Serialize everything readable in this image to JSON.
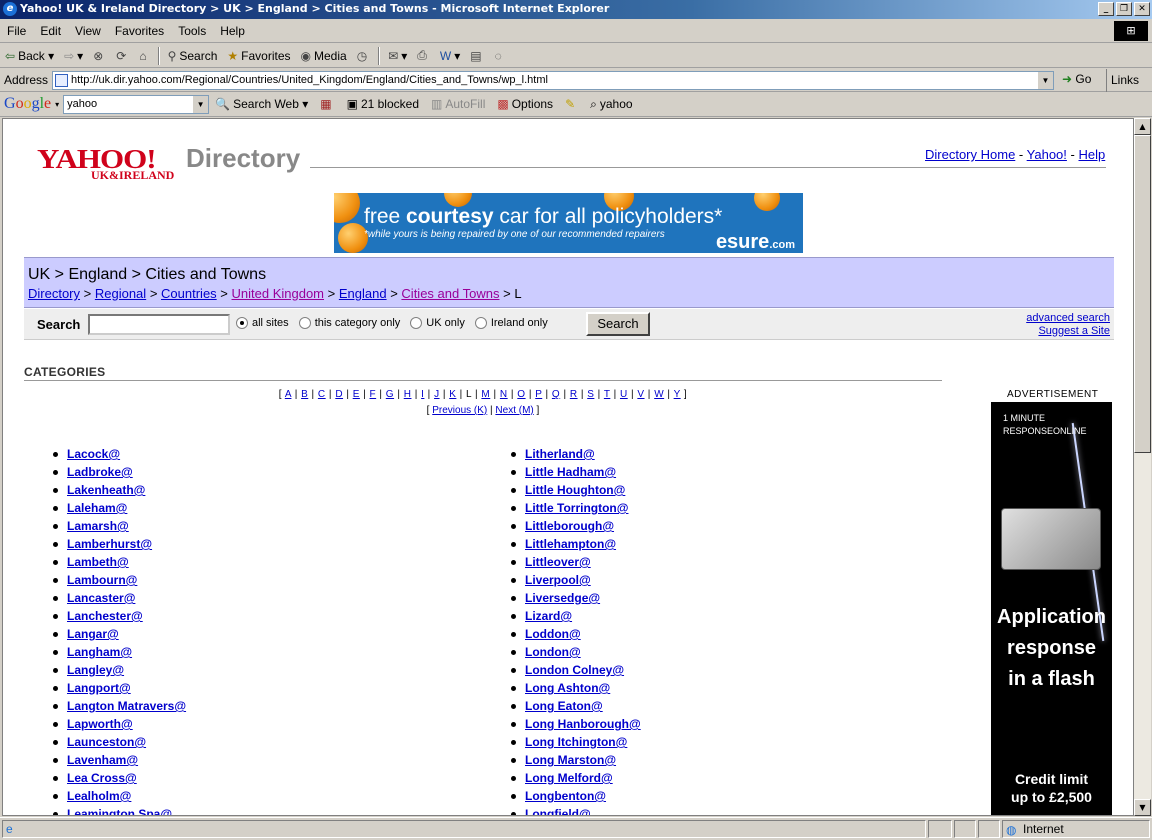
{
  "window": {
    "title": "Yahoo! UK & Ireland Directory > UK > England > Cities and Towns - Microsoft Internet Explorer",
    "min": "_",
    "max": "❐",
    "close": "✕"
  },
  "menu": [
    "File",
    "Edit",
    "View",
    "Favorites",
    "Tools",
    "Help"
  ],
  "toolbar": {
    "back": "Back",
    "search": "Search",
    "favorites": "Favorites",
    "media": "Media"
  },
  "address": {
    "label": "Address",
    "url": "http://uk.dir.yahoo.com/Regional/Countries/United_Kingdom/England/Cities_and_Towns/wp_l.html",
    "go": "Go",
    "links": "Links"
  },
  "google": {
    "logo": [
      "G",
      "o",
      "o",
      "g",
      "l",
      "e"
    ],
    "query": "yahoo",
    "search_web": "Search Web",
    "blocked": "21 blocked",
    "autofill": "AutoFill",
    "options": "Options",
    "yahoo": "yahoo"
  },
  "status": {
    "zone": "Internet"
  },
  "page": {
    "logo_main": "YAHOO!",
    "logo_sub": "UK&IRELAND",
    "logo_dir": "Directory",
    "toplinks": {
      "home": "Directory Home",
      "yahoo": "Yahoo!",
      "help": "Help",
      "sep": "-"
    },
    "banner": {
      "line1_pre": "free ",
      "line1_bold": "courtesy",
      "line1_post": " car for all policyholders*",
      "line2": "*while yours is being repaired by one of our recommended repairers",
      "brand": "esure",
      "brand_tld": ".com"
    },
    "heading": "UK > England > Cities and Towns",
    "crumbs": [
      {
        "label": "Directory",
        "visited": false
      },
      {
        "label": "Regional",
        "visited": false
      },
      {
        "label": "Countries",
        "visited": false
      },
      {
        "label": "United Kingdom",
        "visited": true
      },
      {
        "label": "England",
        "visited": false
      },
      {
        "label": "Cities and Towns",
        "visited": true
      }
    ],
    "crumb_sep": ">",
    "crumb_last": "L",
    "search": {
      "label": "Search",
      "button": "Search",
      "options": [
        "all sites",
        "this category only",
        "UK only",
        "Ireland only"
      ],
      "selected": 0,
      "advanced": "advanced search",
      "suggest": "Suggest a Site"
    },
    "categories_title": "CATEGORIES",
    "letters": [
      "A",
      "B",
      "C",
      "D",
      "E",
      "F",
      "G",
      "H",
      "I",
      "J",
      "K",
      "L",
      "M",
      "N",
      "O",
      "P",
      "Q",
      "R",
      "S",
      "T",
      "U",
      "V",
      "W",
      "Y"
    ],
    "current_letter": "L",
    "prev": "Previous (K)",
    "next": "Next (M)",
    "col1": [
      "Lacock@",
      "Ladbroke@",
      "Lakenheath@",
      "Laleham@",
      "Lamarsh@",
      "Lamberhurst@",
      "Lambeth@",
      "Lambourn@",
      "Lancaster@",
      "Lanchester@",
      "Langar@",
      "Langham@",
      "Langley@",
      "Langport@",
      "Langton Matravers@",
      "Lapworth@",
      "Launceston@",
      "Lavenham@",
      "Lea Cross@",
      "Lealholm@",
      "Leamington Spa@"
    ],
    "col2": [
      "Litherland@",
      "Little Hadham@",
      "Little Houghton@",
      "Little Torrington@",
      "Littleborough@",
      "Littlehampton@",
      "Littleover@",
      "Liverpool@",
      "Liversedge@",
      "Lizard@",
      "Loddon@",
      "London@",
      "London Colney@",
      "Long Ashton@",
      "Long Eaton@",
      "Long Hanborough@",
      "Long Itchington@",
      "Long Marston@",
      "Long Melford@",
      "Longbenton@",
      "Longfield@"
    ],
    "ad": {
      "label": "ADVERTISEMENT",
      "top1": "1 MINUTE",
      "top2": "RESPONSEONLINE",
      "mid1": "Application",
      "mid2": "response",
      "mid3": "in a flash",
      "bot1": "Credit limit",
      "bot2": "up to £2,500"
    }
  }
}
